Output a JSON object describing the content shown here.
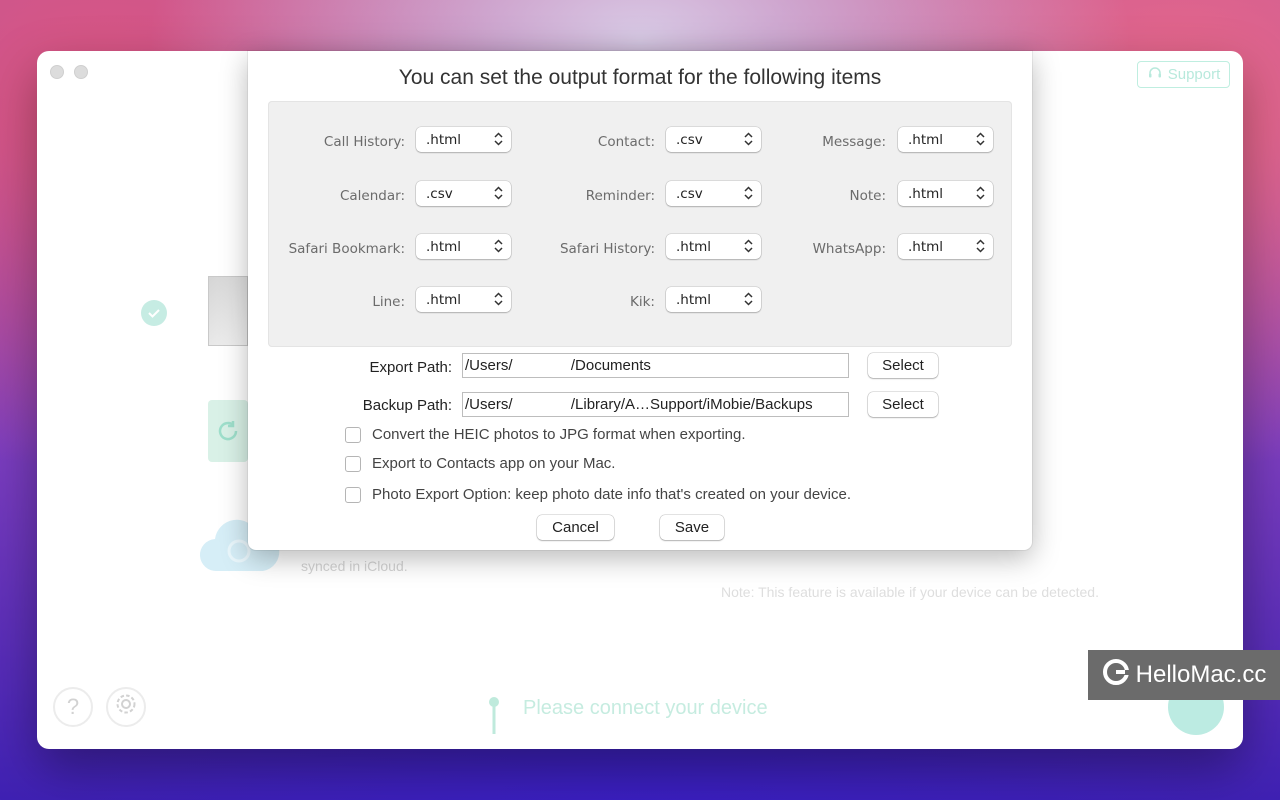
{
  "window": {
    "support_label": "Support",
    "background_text_synced": "synced in iCloud.",
    "background_note": "Note: This feature is available if your device can be detected.",
    "connect_prompt": "Please connect your device",
    "help_glyph": "?"
  },
  "dialog": {
    "title": "You can set the output format for the following items",
    "formats": [
      {
        "label": "Call History:",
        "value": ".html"
      },
      {
        "label": "Contact:",
        "value": ".csv"
      },
      {
        "label": "Message:",
        "value": ".html"
      },
      {
        "label": "Calendar:",
        "value": ".csv"
      },
      {
        "label": "Reminder:",
        "value": ".csv"
      },
      {
        "label": "Note:",
        "value": ".html"
      },
      {
        "label": "Safari Bookmark:",
        "value": ".html"
      },
      {
        "label": "Safari History:",
        "value": ".html"
      },
      {
        "label": "WhatsApp:",
        "value": ".html"
      },
      {
        "label": "Line:",
        "value": ".html"
      },
      {
        "label": "Kik:",
        "value": ".html"
      }
    ],
    "export_path": {
      "label": "Export Path:",
      "value": "/Users/              /Documents",
      "button": "Select"
    },
    "backup_path": {
      "label": "Backup Path:",
      "value": "/Users/              /Library/A…Support/iMobie/Backups",
      "button": "Select"
    },
    "options": [
      {
        "label": "Convert the HEIC photos to JPG format when exporting.",
        "checked": false
      },
      {
        "label": "Export to Contacts app on your Mac.",
        "checked": false
      },
      {
        "label": "Photo Export Option: keep photo date info that's created on your device.",
        "checked": false
      }
    ],
    "cancel_label": "Cancel",
    "save_label": "Save"
  },
  "watermark": {
    "text": "HelloMac.cc"
  }
}
